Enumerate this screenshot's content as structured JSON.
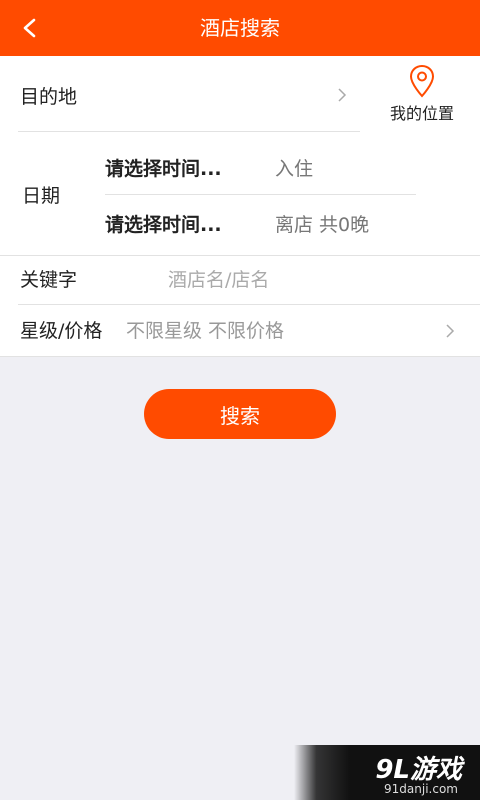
{
  "header": {
    "title": "酒店搜索"
  },
  "destination": {
    "label": "目的地"
  },
  "location": {
    "label": "我的位置"
  },
  "date": {
    "label": "日期",
    "checkin": {
      "value": "请选择时间...",
      "suffix": "入住"
    },
    "checkout": {
      "value": "请选择时间...",
      "suffix": "离店 共0晚"
    }
  },
  "keyword": {
    "label": "关键字",
    "placeholder": "酒店名/店名",
    "value": ""
  },
  "star_price": {
    "label": "星级/价格",
    "value": "不限星级 不限价格"
  },
  "search_button": {
    "label": "搜索"
  },
  "watermark": {
    "main": "9L游戏",
    "sub": "91danji.com"
  },
  "colors": {
    "accent": "#ff4b00",
    "background": "#efeff4",
    "divider": "#e2e2e2"
  }
}
